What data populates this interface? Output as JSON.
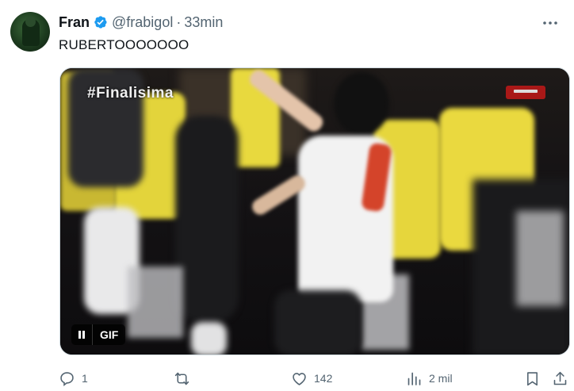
{
  "author": {
    "name": "Fran",
    "handle": "@frabigol",
    "separator": "·",
    "time": "33min",
    "verified": true,
    "avatar_icon": "avatar-player-photo"
  },
  "tweet": {
    "text": "RUBERTOOOOOOO"
  },
  "media": {
    "overlay_tag": "#Finalisima",
    "gif_label": "GIF",
    "pause_icon": "pause-icon"
  },
  "actions": {
    "reply": {
      "icon": "reply-icon",
      "count": "1"
    },
    "retweet": {
      "icon": "retweet-icon",
      "count": ""
    },
    "like": {
      "icon": "heart-icon",
      "count": "142"
    },
    "views": {
      "icon": "views-chart-icon",
      "count": "2 mil"
    },
    "bookmark": {
      "icon": "bookmark-icon"
    },
    "share": {
      "icon": "share-icon"
    }
  },
  "colors": {
    "text_primary": "#0f1419",
    "text_secondary": "#536471",
    "verified_blue": "#1d9bf0",
    "vest_yellow": "#e2d23a"
  }
}
